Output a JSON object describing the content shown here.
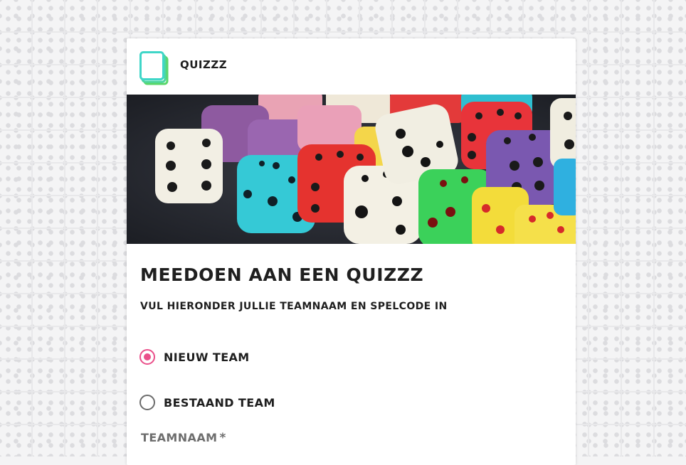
{
  "app": {
    "brand_name": "QUIZZZ"
  },
  "banner": {
    "icon": "dice-photo"
  },
  "form": {
    "title": "MEEDOEN AAN EEN QUIZZZ",
    "subtitle": "VUL HIERONDER JULLIE TEAMNAAM EN SPELCODE IN",
    "options": [
      {
        "label": "NIEUW TEAM",
        "selected": true
      },
      {
        "label": "BESTAAND TEAM",
        "selected": false
      }
    ],
    "team_name_label": "TEAMNAAM",
    "required_marker": "*"
  },
  "colors": {
    "accent": "#ea4f8a",
    "logo_teal": "#3fd6c8",
    "logo_green": "#5ad66a",
    "text": "#1f1f1f"
  }
}
